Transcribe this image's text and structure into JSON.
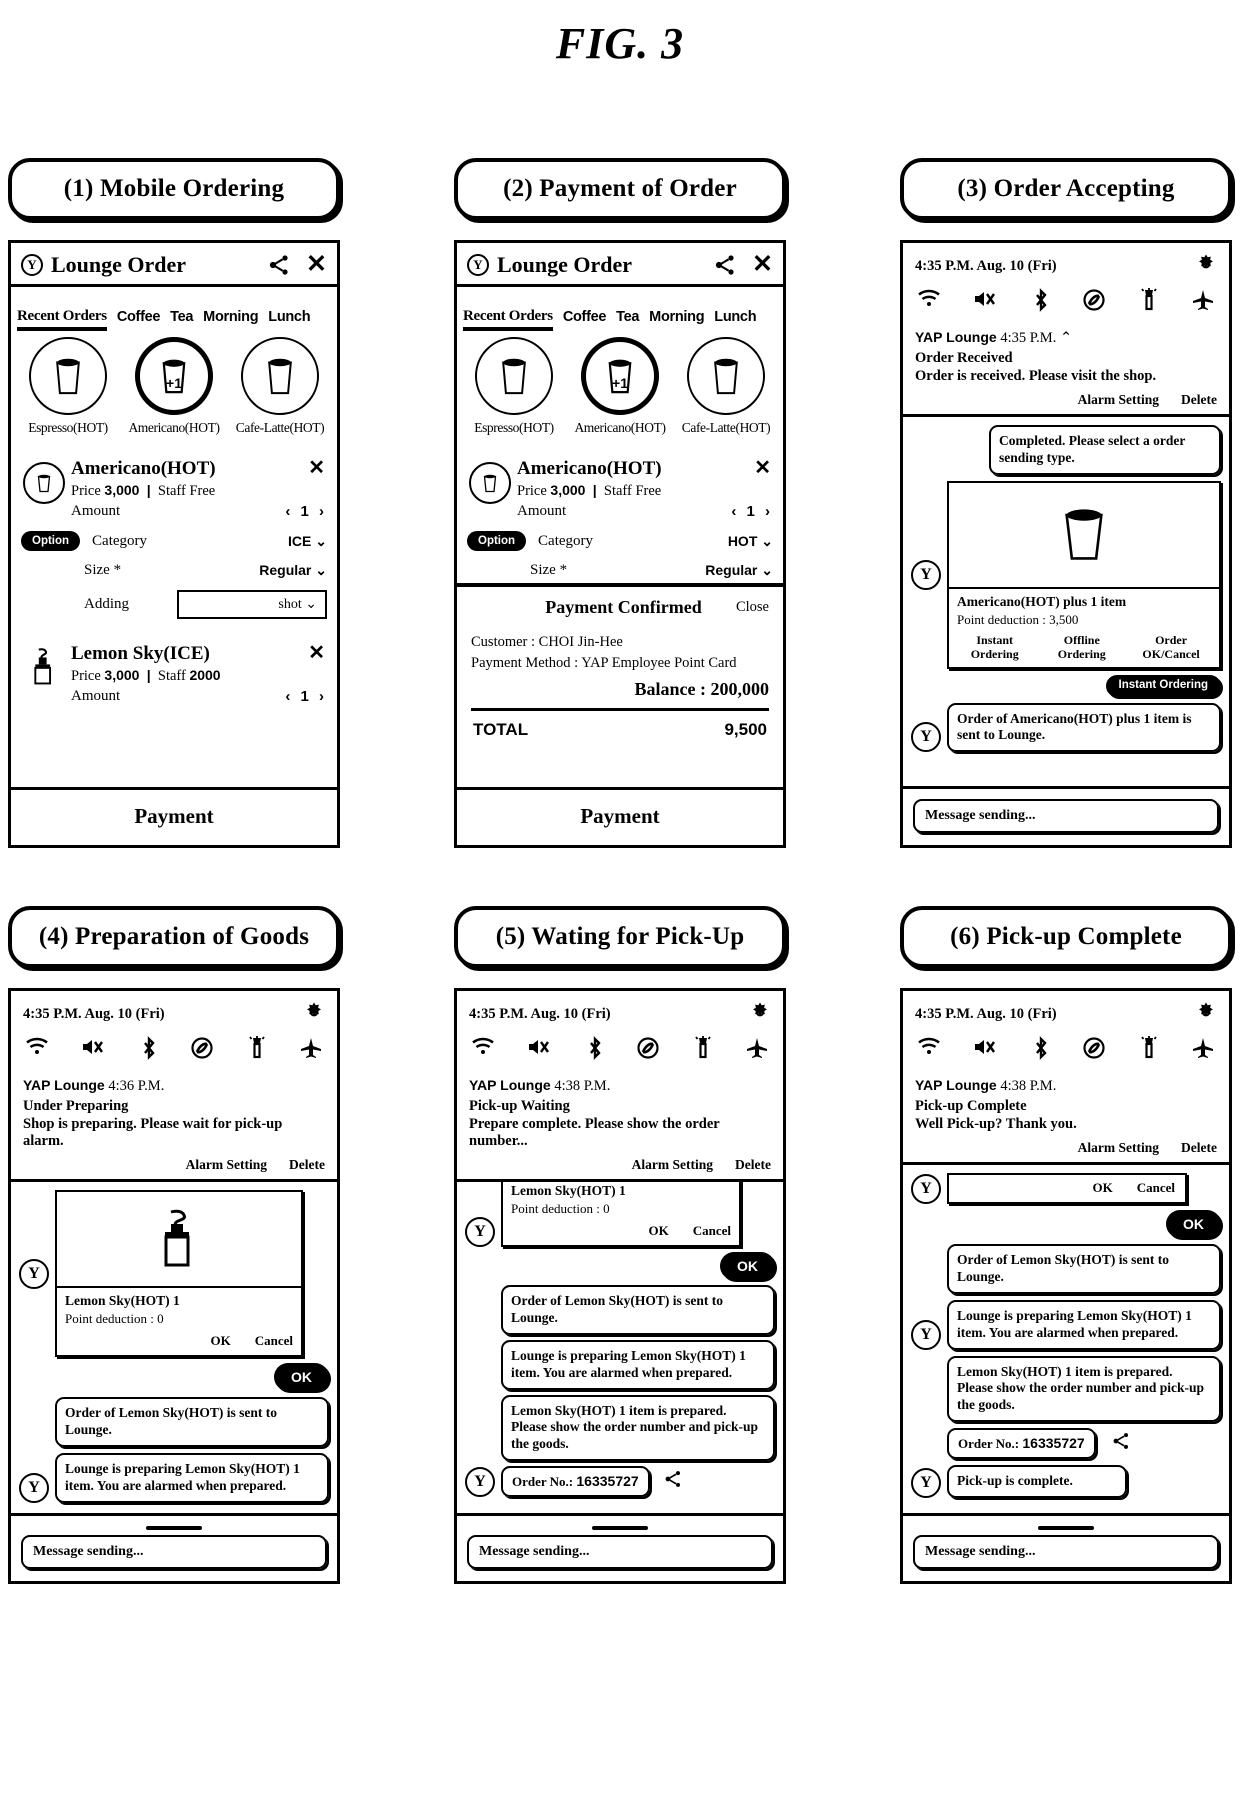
{
  "figure": {
    "title": "FIG. 3"
  },
  "panels": [
    {
      "caption": "(1) Mobile Ordering",
      "type": "order-app",
      "app": {
        "logo": "Y",
        "title": "Lounge Order",
        "share_icon": "share-icon",
        "close_icon": "close-icon"
      },
      "tabs": [
        {
          "label": "Recent Orders",
          "active": true
        },
        {
          "label": "Coffee",
          "active": false
        },
        {
          "label": "Tea",
          "active": false
        },
        {
          "label": "Morning",
          "active": false
        },
        {
          "label": "Lunch",
          "active": false
        }
      ],
      "products": [
        {
          "label": "Espresso(HOT)",
          "selected": false,
          "badge": ""
        },
        {
          "label": "Americano(HOT)",
          "selected": true,
          "badge": "+1"
        },
        {
          "label": "Cafe-Latte(HOT)",
          "selected": false,
          "badge": ""
        }
      ],
      "items": [
        {
          "name": "Americano(HOT)",
          "price_label": "Price",
          "price": "3,000",
          "staff_label": "Staff",
          "staff": "Free",
          "amount_label": "Amount",
          "amount": "1",
          "icon": "cup-icon",
          "options": [
            {
              "badge": "Option",
              "label": "Category",
              "value": "ICE",
              "boxed": false
            },
            {
              "badge": "",
              "label": "Size *",
              "value": "Regular",
              "boxed": false
            },
            {
              "badge": "",
              "label": "Adding",
              "value": "shot",
              "boxed": true
            }
          ]
        },
        {
          "name": "Lemon Sky(ICE)",
          "price_label": "Price",
          "price": "3,000",
          "staff_label": "Staff",
          "staff": "2000",
          "amount_label": "Amount",
          "amount": "1",
          "icon": "bottle-icon",
          "options": []
        }
      ],
      "payment_button": "Payment"
    },
    {
      "caption": "(2) Payment of Order",
      "type": "order-app-payment",
      "app": {
        "logo": "Y",
        "title": "Lounge Order",
        "share_icon": "share-icon",
        "close_icon": "close-icon"
      },
      "tabs": [
        {
          "label": "Recent Orders",
          "active": true
        },
        {
          "label": "Coffee",
          "active": false
        },
        {
          "label": "Tea",
          "active": false
        },
        {
          "label": "Morning",
          "active": false
        },
        {
          "label": "Lunch",
          "active": false
        }
      ],
      "products": [
        {
          "label": "Espresso(HOT)",
          "selected": false,
          "badge": ""
        },
        {
          "label": "Americano(HOT)",
          "selected": true,
          "badge": "+1"
        },
        {
          "label": "Cafe-Latte(HOT)",
          "selected": false,
          "badge": ""
        }
      ],
      "items": [
        {
          "name": "Americano(HOT)",
          "price_label": "Price",
          "price": "3,000",
          "staff_label": "Staff",
          "staff": "Free",
          "amount_label": "Amount",
          "amount": "1",
          "icon": "cup-icon",
          "options": [
            {
              "badge": "Option",
              "label": "Category",
              "value": "HOT",
              "boxed": false
            },
            {
              "badge": "",
              "label": "Size *",
              "value": "Regular",
              "boxed": false
            }
          ]
        }
      ],
      "sheet": {
        "title": "Payment Confirmed",
        "close": "Close",
        "customer": "Customer : CHOI Jin-Hee",
        "method": "Payment Method : YAP Employee Point Card",
        "balance": "Balance : 200,000",
        "total_label": "TOTAL",
        "total_value": "9,500"
      },
      "payment_button": "Payment"
    },
    {
      "caption": "(3) Order Accepting",
      "type": "messenger",
      "status": {
        "time": "4:35 P.M. Aug. 10 (Fri)",
        "gear": "gear-icon"
      },
      "sys_icons": [
        "wifi-icon",
        "mute-icon",
        "bluetooth-icon",
        "rotate-lock-icon",
        "flashlight-icon",
        "airplane-icon"
      ],
      "notification": {
        "sender": "YAP Lounge",
        "time": "4:35 P.M.",
        "chevron": "chevron-up-icon",
        "line1": "Order Received",
        "line2": "Order is received. Please visit the shop.",
        "action1": "Alarm Setting",
        "action2": "Delete"
      },
      "chat": [
        {
          "kind": "bubble-right",
          "text": "Completed. Please select a order sending type."
        },
        {
          "kind": "order-card",
          "avatar": "Y",
          "image": "cup-icon",
          "title": "Americano(HOT) plus 1 item",
          "subtitle": "Point deduction : 3,500",
          "buttons": [
            "Instant Ordering",
            "Offline Ordering",
            "Order OK/Cancel"
          ]
        },
        {
          "kind": "pill-right",
          "text": "Instant Ordering",
          "two_line": true
        },
        {
          "kind": "bubble-left",
          "avatar": "Y",
          "text": "Order of Americano(HOT) plus 1 item is sent to Lounge."
        }
      ],
      "input_placeholder": "Message sending..."
    },
    {
      "caption": "(4) Preparation of Goods",
      "type": "messenger",
      "status": {
        "time": "4:35 P.M. Aug. 10 (Fri)",
        "gear": "gear-icon"
      },
      "sys_icons": [
        "wifi-icon",
        "mute-icon",
        "bluetooth-icon",
        "rotate-lock-icon",
        "flashlight-icon",
        "airplane-icon"
      ],
      "notification": {
        "sender": "YAP Lounge",
        "time": "4:36 P.M.",
        "chevron": "",
        "line1": "Under Preparing",
        "line2": "Shop is preparing. Please wait for pick-up alarm.",
        "action1": "Alarm Setting",
        "action2": "Delete"
      },
      "chat": [
        {
          "kind": "order-card2",
          "avatar": "Y",
          "image": "bottle-icon",
          "title": "Lemon Sky(HOT)  1",
          "subtitle": "Point deduction : 0",
          "buttons": [
            "OK",
            "Cancel"
          ]
        },
        {
          "kind": "pill-right",
          "text": "OK",
          "two_line": false
        },
        {
          "kind": "bubble-left-noava",
          "text": "Order of Lemon Sky(HOT) is sent to Lounge."
        },
        {
          "kind": "bubble-left",
          "avatar": "Y",
          "text": "Lounge is preparing Lemon Sky(HOT) 1 item. You are alarmed when prepared."
        }
      ],
      "input_placeholder": "Message sending..."
    },
    {
      "caption": "(5) Wating for Pick-Up",
      "type": "messenger",
      "status": {
        "time": "4:35 P.M. Aug. 10 (Fri)",
        "gear": "gear-icon"
      },
      "sys_icons": [
        "wifi-icon",
        "mute-icon",
        "bluetooth-icon",
        "rotate-lock-icon",
        "flashlight-icon",
        "airplane-icon"
      ],
      "notification": {
        "sender": "YAP Lounge",
        "time": "4:38 P.M.",
        "chevron": "",
        "line1": "Pick-up Waiting",
        "line2": "Prepare complete. Please show the order number...",
        "action1": "Alarm Setting",
        "action2": "Delete"
      },
      "chat": [
        {
          "kind": "order-card-cut",
          "avatar": "Y",
          "title": "Lemon Sky(HOT)  1",
          "subtitle": "Point deduction : 0",
          "buttons": [
            "OK",
            "Cancel"
          ]
        },
        {
          "kind": "pill-right",
          "text": "OK",
          "two_line": false
        },
        {
          "kind": "bubble-left-noava",
          "text": "Order of Lemon Sky(HOT) is sent to Lounge."
        },
        {
          "kind": "bubble-left",
          "avatar": "Y",
          "text": "Lounge is preparing Lemon Sky(HOT) 1 item. You are alarmed when prepared."
        },
        {
          "kind": "bubble-left-noava",
          "text": "Lemon Sky(HOT) 1 item is prepared. Please show the order number and pick-up the goods."
        },
        {
          "kind": "order-no",
          "avatar": "Y",
          "label": "Order No.:",
          "value": "16335727",
          "share": "share-icon"
        }
      ],
      "input_placeholder": "Message sending..."
    },
    {
      "caption": "(6) Pick-up Complete",
      "type": "messenger",
      "status": {
        "time": "4:35 P.M. Aug. 10 (Fri)",
        "gear": "gear-icon"
      },
      "sys_icons": [
        "wifi-icon",
        "mute-icon",
        "bluetooth-icon",
        "rotate-lock-icon",
        "flashlight-icon",
        "airplane-icon"
      ],
      "notification": {
        "sender": "YAP Lounge",
        "time": "4:38 P.M.",
        "chevron": "",
        "line1": "Pick-up Complete",
        "line2": "Well Pick-up? Thank you.",
        "action1": "Alarm Setting",
        "action2": "Delete"
      },
      "chat": [
        {
          "kind": "okcancel-row",
          "avatar": "Y",
          "buttons": [
            "OK",
            "Cancel"
          ]
        },
        {
          "kind": "pill-right",
          "text": "OK",
          "two_line": false
        },
        {
          "kind": "bubble-left-noava",
          "text": "Order of Lemon Sky(HOT) is sent to Lounge."
        },
        {
          "kind": "bubble-left",
          "avatar": "Y",
          "text": "Lounge is preparing Lemon Sky(HOT) 1 item. You are alarmed when prepared."
        },
        {
          "kind": "bubble-left-noava",
          "text": "Lemon Sky(HOT) 1 item is prepared. Please show the order number and pick-up the goods."
        },
        {
          "kind": "order-no",
          "avatar": "",
          "label": "Order No.:",
          "value": "16335727",
          "share": "share-icon"
        },
        {
          "kind": "bubble-left",
          "avatar": "Y",
          "text": "Pick-up is complete."
        }
      ],
      "input_placeholder": "Message sending..."
    }
  ]
}
